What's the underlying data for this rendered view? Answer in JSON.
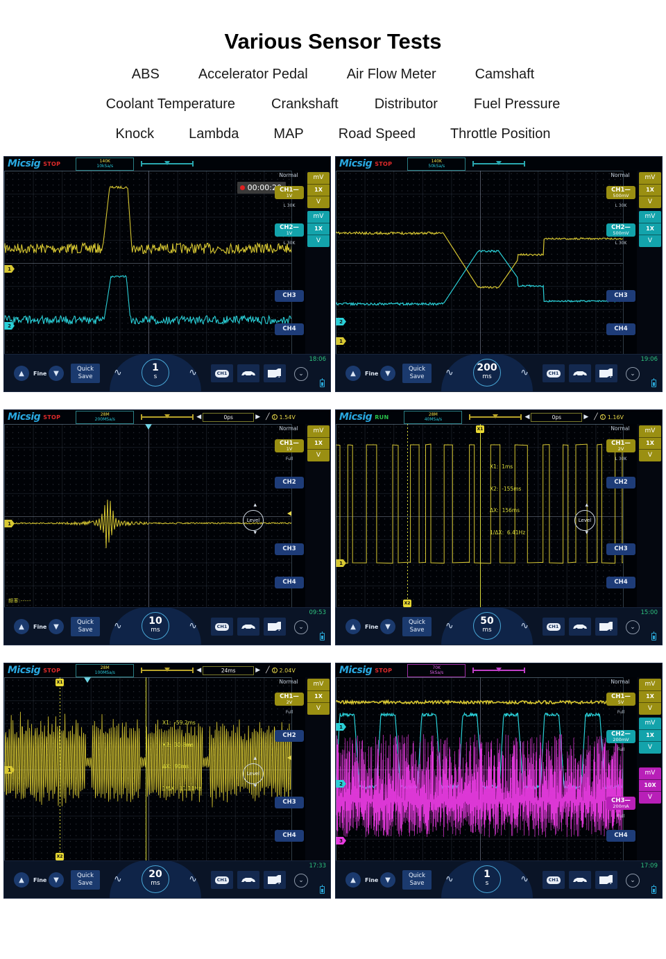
{
  "header": {
    "title": "Various Sensor Tests",
    "sensor_rows": [
      [
        "ABS",
        "Accelerator Pedal",
        "Air Flow Meter",
        "Camshaft"
      ],
      [
        "Coolant Temperature",
        "Crankshaft",
        "Distributor",
        "Fuel Pressure"
      ],
      [
        "Knock",
        "Lambda",
        "MAP",
        "Road Speed",
        "Throttle Position"
      ]
    ]
  },
  "common": {
    "brand": "Micsig",
    "trigger_mode": "Normal",
    "fine_label": "Fine",
    "quick_save_line1": "Quick",
    "quick_save_line2": "Save",
    "up_arrow": "▲",
    "down_arrow": "▼",
    "sine_glyph": "∿",
    "chevron_glyph": "⌄",
    "chip_label": "CH1",
    "level_label": "Level",
    "unit_mv": "mV",
    "unit_v": "V",
    "probe_1x": "1X",
    "probe_10x": "10X",
    "slope_glyph": "╱",
    "trig_src_glyph": "①",
    "left_arrow": "◀",
    "right_arrow": "▶",
    "colors": {
      "ch1": "#9a8f12",
      "ch2": "#13a3ab",
      "ch3": "#b81fb8",
      "ch_inactive": "#1e3c78",
      "brand_blue": "#29a8e0",
      "stop_red": "#e02a2a",
      "run_green": "#28c24a",
      "cursor_yellow": "#dede3a",
      "screen_bg": "#000206"
    }
  },
  "scopes": [
    {
      "id": "scope-1",
      "run_state": "STOP",
      "mem_depth": "140K",
      "sample_rate": "10kSa/s",
      "timebase_value": "1",
      "timebase_unit": "s",
      "clock": "18:06",
      "record_timer": "00:00:20",
      "has_record_timer": true,
      "has_delay_box": false,
      "channels": [
        {
          "name": "CH1",
          "scale": "1V",
          "coupling": "L 30K",
          "active": true,
          "color_key": "ch1",
          "probe": "1X"
        },
        {
          "name": "CH2",
          "scale": "1V",
          "coupling": "L 30K",
          "active": true,
          "color_key": "ch2",
          "probe": "1X"
        },
        {
          "name": "CH3",
          "active": false
        },
        {
          "name": "CH4",
          "active": false
        }
      ]
    },
    {
      "id": "scope-2",
      "run_state": "STOP",
      "mem_depth": "140K",
      "sample_rate": "50kSa/s",
      "timebase_value": "200",
      "timebase_unit": "ms",
      "clock": "19:06",
      "has_record_timer": false,
      "has_delay_box": false,
      "channels": [
        {
          "name": "CH1",
          "scale": "500mV",
          "coupling": "L 30K",
          "active": true,
          "color_key": "ch1",
          "probe": "1X"
        },
        {
          "name": "CH2",
          "scale": "500mV",
          "coupling": "L 30K",
          "active": true,
          "color_key": "ch2",
          "probe": "1X"
        },
        {
          "name": "CH3",
          "active": false
        },
        {
          "name": "CH4",
          "active": false
        }
      ]
    },
    {
      "id": "scope-3",
      "run_state": "STOP",
      "mem_depth": "28M",
      "sample_rate": "200MSa/s",
      "delay": "0ps",
      "trigger_level": "1.54V",
      "timebase_value": "10",
      "timebase_unit": "ms",
      "clock": "09:53",
      "has_record_timer": false,
      "has_delay_box": true,
      "freq_label": "频率:-----",
      "channels": [
        {
          "name": "CH1",
          "scale": "1V",
          "coupling": "Full",
          "active": true,
          "color_key": "ch1",
          "probe": "1X"
        },
        {
          "name": "CH2",
          "active": false
        },
        {
          "name": "CH3",
          "active": false
        },
        {
          "name": "CH4",
          "active": false
        }
      ]
    },
    {
      "id": "scope-4",
      "run_state": "RUN",
      "mem_depth": "28M",
      "sample_rate": "40MSa/s",
      "delay": "0ps",
      "trigger_level": "1.16V",
      "timebase_value": "50",
      "timebase_unit": "ms",
      "clock": "15:00",
      "has_record_timer": false,
      "has_delay_box": true,
      "cursors": {
        "x1_label": "X1:",
        "x1_value": "1ms",
        "x2_label": "X2:",
        "x2_value": "-155ms",
        "dx_label": "ΔX:",
        "dx_value": "156ms",
        "fx_label": "1/ΔX:",
        "fx_value": "6.41Hz"
      },
      "channels": [
        {
          "name": "CH1",
          "scale": "2V",
          "coupling": "L 30K",
          "active": true,
          "color_key": "ch1",
          "probe": "1X"
        },
        {
          "name": "CH2",
          "active": false
        },
        {
          "name": "CH3",
          "active": false
        },
        {
          "name": "CH4",
          "active": false
        }
      ]
    },
    {
      "id": "scope-5",
      "run_state": "STOP",
      "mem_depth": "28M",
      "sample_rate": "100MSa/s",
      "delay": "24ms",
      "trigger_level": "2.04V",
      "timebase_value": "20",
      "timebase_unit": "ms",
      "clock": "17:33",
      "has_record_timer": false,
      "has_delay_box": true,
      "cursors": {
        "x1_label": "X1:",
        "x1_value": "-59.2ms",
        "x2_label": "X2:",
        "x2_value": "30.8ms",
        "dx_label": "ΔX:",
        "dx_value": "90ms",
        "fx_label": "1/ΔX:",
        "fx_value": "11.11Hz"
      },
      "channels": [
        {
          "name": "CH1",
          "scale": "2V",
          "coupling": "Full",
          "active": true,
          "color_key": "ch1",
          "probe": "1X"
        },
        {
          "name": "CH2",
          "active": false
        },
        {
          "name": "CH3",
          "active": false
        },
        {
          "name": "CH4",
          "active": false
        }
      ]
    },
    {
      "id": "scope-6",
      "run_state": "STOP",
      "mem_depth": "70K",
      "sample_rate": "5kSa/s",
      "timebase_value": "1",
      "timebase_unit": "s",
      "clock": "17:09",
      "has_record_timer": false,
      "has_delay_box": false,
      "channels": [
        {
          "name": "CH1",
          "scale": "5V",
          "coupling": "Full",
          "active": true,
          "color_key": "ch1",
          "probe": "1X"
        },
        {
          "name": "CH2",
          "scale": "200mV",
          "coupling": "Full",
          "active": true,
          "color_key": "ch2",
          "probe": "1X"
        },
        {
          "name": "CH3",
          "scale": "200mA",
          "coupling": "Full",
          "active": true,
          "color_key": "ch3",
          "probe": "10X"
        },
        {
          "name": "CH4",
          "active": false
        }
      ]
    }
  ]
}
